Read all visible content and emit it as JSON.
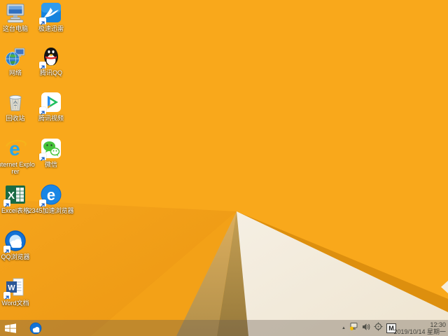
{
  "wallpaper": {
    "description": "Windows 8.1 default orange faceted wallpaper",
    "base_color": "#F9A81B",
    "wedge_color": "#F19E15",
    "ridge_color": "#DD8F0E",
    "shadow_color": "#B08C42",
    "cream_color": "#F3ECDE"
  },
  "desktop": {
    "icons": [
      {
        "name": "this-pc",
        "label": "这台电脑"
      },
      {
        "name": "thunder-speed",
        "label": "极速迅雷"
      },
      {
        "name": "network",
        "label": "网络"
      },
      {
        "name": "tencent-qq",
        "label": "腾讯QQ"
      },
      {
        "name": "recycle-bin",
        "label": "回收站"
      },
      {
        "name": "tencent-video",
        "label": "腾讯视频"
      },
      {
        "name": "internet-explorer",
        "label": "Internet Explorer"
      },
      {
        "name": "wechat",
        "label": "微信"
      },
      {
        "name": "excel",
        "label": "Excel表格"
      },
      {
        "name": "browser-2345",
        "label": "2345加速浏览器"
      },
      {
        "name": "qq-browser",
        "label": "QQ浏览器"
      },
      {
        "name": "word",
        "label": "Word文档"
      }
    ]
  },
  "taskbar": {
    "pinned_icons": [
      "windows-start",
      "qq-browser"
    ],
    "tray": {
      "icon_names": [
        "hidden-icons-chevron",
        "network-warning",
        "volume",
        "safety-target",
        "input-method-indicator"
      ],
      "input_indicator": "M",
      "time": "12:30",
      "date": "2019/10/14 星期一"
    }
  }
}
